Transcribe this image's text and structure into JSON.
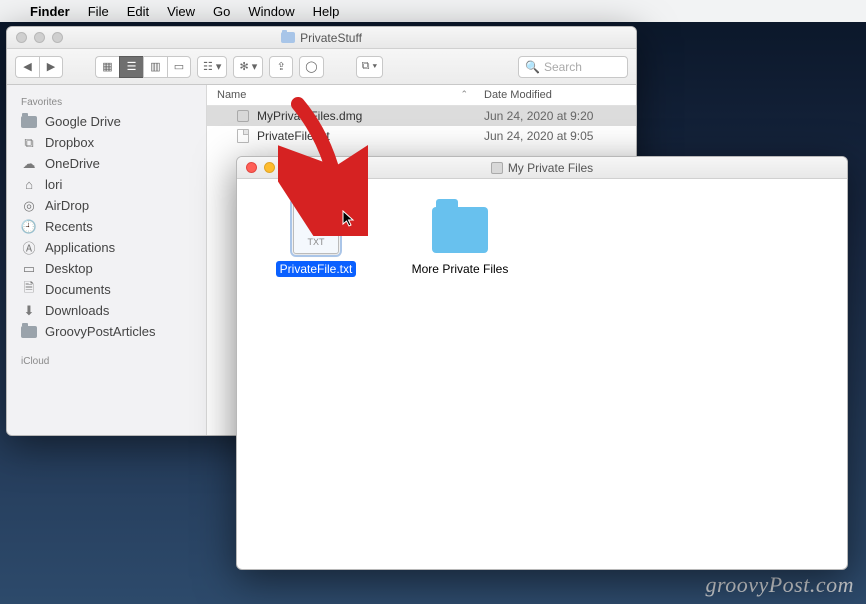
{
  "menubar": {
    "app": "Finder",
    "items": [
      "File",
      "Edit",
      "View",
      "Go",
      "Window",
      "Help"
    ]
  },
  "back_window": {
    "title": "PrivateStuff",
    "search_placeholder": "Search",
    "columns": {
      "name": "Name",
      "date": "Date Modified"
    },
    "rows": [
      {
        "name": "MyPrivateFiles.dmg",
        "date": "Jun 24, 2020 at 9:20",
        "selected": true,
        "icon": "disk"
      },
      {
        "name": "PrivateFile.txt",
        "date": "Jun 24, 2020 at 9:05",
        "selected": false,
        "icon": "doc"
      }
    ],
    "sidebar": {
      "favorites_header": "Favorites",
      "favorites": [
        {
          "label": "Google Drive",
          "icon": "folder"
        },
        {
          "label": "Dropbox",
          "icon": "dropbox"
        },
        {
          "label": "OneDrive",
          "icon": "cloud"
        },
        {
          "label": "lori",
          "icon": "home"
        },
        {
          "label": "AirDrop",
          "icon": "airdrop"
        },
        {
          "label": "Recents",
          "icon": "clock"
        },
        {
          "label": "Applications",
          "icon": "apps"
        },
        {
          "label": "Desktop",
          "icon": "desktop"
        },
        {
          "label": "Documents",
          "icon": "docs"
        },
        {
          "label": "Downloads",
          "icon": "downloads"
        },
        {
          "label": "GroovyPostArticles",
          "icon": "folder"
        }
      ],
      "icloud_header": "iCloud"
    }
  },
  "front_window": {
    "title": "My Private Files",
    "items": [
      {
        "label": "PrivateFile.txt",
        "selected": true,
        "kind": "txt"
      },
      {
        "label": "More Private Files",
        "selected": false,
        "kind": "folder"
      }
    ]
  },
  "watermark": "groovyPost.com"
}
